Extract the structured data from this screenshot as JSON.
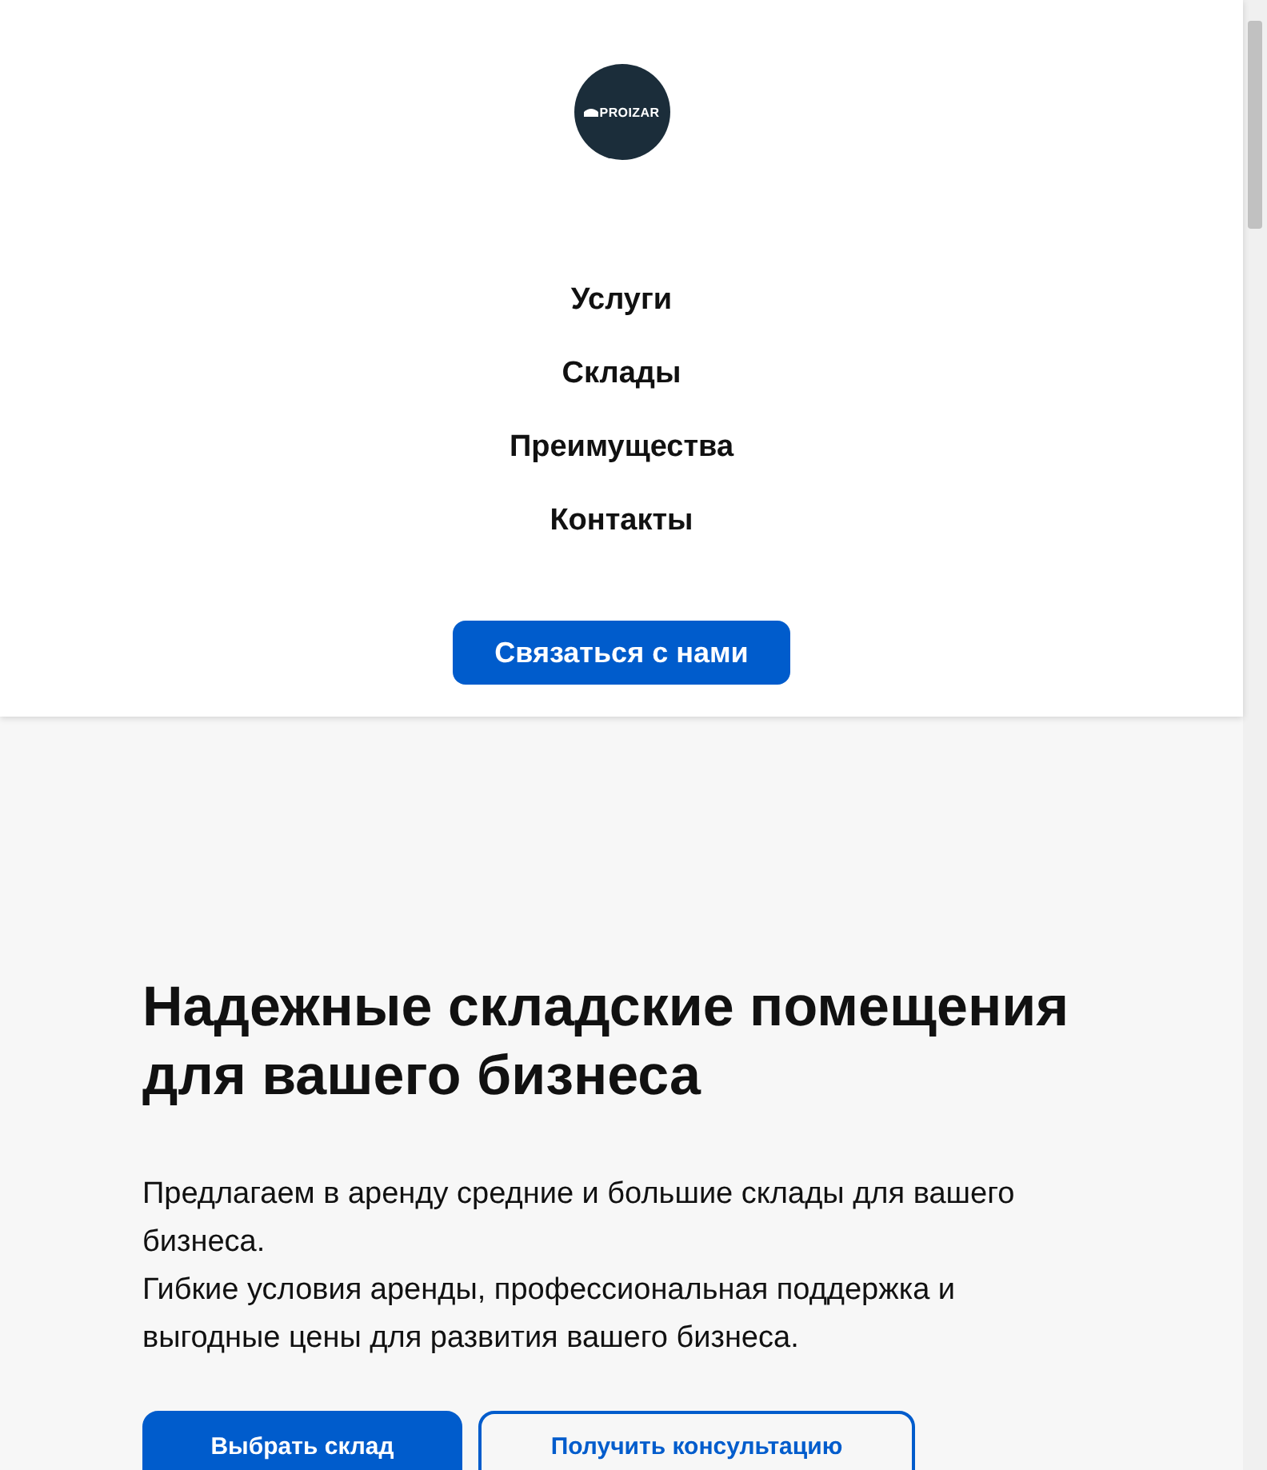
{
  "logo": {
    "text": "PROIZAR"
  },
  "nav": [
    {
      "label": "Услуги"
    },
    {
      "label": "Склады"
    },
    {
      "label": "Преимущества"
    },
    {
      "label": "Контакты"
    }
  ],
  "contact_button": "Связаться с нами",
  "hero": {
    "title": "Надежные складские помещения для вашего бизнеса",
    "paragraphs": [
      "Предлагаем в аренду средние и большие склады для вашего бизнеса.",
      "Гибкие условия аренды, профессиональная поддержка и выгодные цены для развития вашего бизнеса."
    ],
    "buttons": [
      {
        "label": "Выбрать склад",
        "kind": "primary"
      },
      {
        "label": "Получить консультацию",
        "kind": "outline"
      }
    ]
  }
}
